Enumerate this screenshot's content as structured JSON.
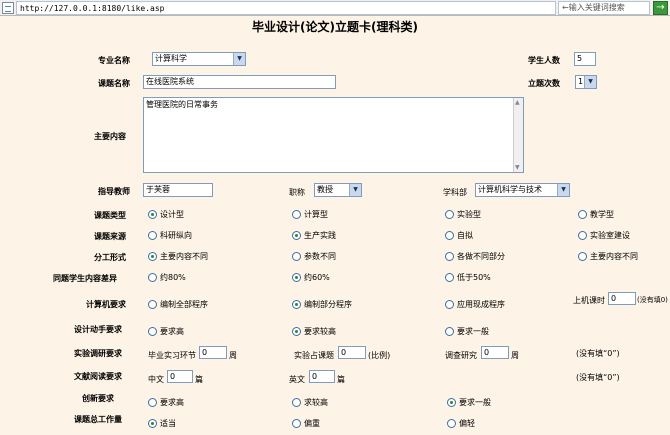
{
  "address": {
    "url": "http://127.0.0.1:8180/like.asp",
    "search_placeholder": "←输入关键词搜索",
    "go_label": "→"
  },
  "title": "毕业设计(论文)立题卡(理科类)",
  "major": {
    "label": "专业名称",
    "value": "计算科学"
  },
  "student_count": {
    "label": "学生人数",
    "value": "5"
  },
  "topic_name": {
    "label": "课题名称",
    "value": "在线医院系统"
  },
  "topic_times": {
    "label": "立题次数",
    "value": "1"
  },
  "main_content": {
    "label": "主要内容",
    "value": "管理医院的日常事务"
  },
  "teacher": {
    "label": "指导教师",
    "value": "于芙蓉"
  },
  "rank": {
    "label": "职称",
    "value": "教授"
  },
  "dept": {
    "label": "学科部",
    "value": "计算机科学与技术"
  },
  "topic_type": {
    "label": "课题类型",
    "options": [
      "设计型",
      "计算型",
      "实验型",
      "教学型"
    ],
    "selected": 0
  },
  "topic_source": {
    "label": "课题来源",
    "options": [
      "科研纵向",
      "生产实践",
      "自拟",
      "实验室建设"
    ],
    "selected": 1
  },
  "division": {
    "label": "分工形式",
    "options": [
      "主要内容不同",
      "参数不同",
      "各做不同部分",
      "主要内容不同"
    ],
    "selected": 0
  },
  "diff": {
    "label": "同题学生内容差异",
    "options": [
      "约80%",
      "约60%",
      "低于50%"
    ],
    "selected": 1
  },
  "computer_req": {
    "label": "计算机要求",
    "options": [
      "编制全部程序",
      "编制部分程序",
      "应用现成程序"
    ],
    "selected": 1,
    "hours_label": "上机课时",
    "hours_value": "0",
    "hours_note": "(没有填0)"
  },
  "design_req": {
    "label": "设计动手要求",
    "options": [
      "要求高",
      "要求较高",
      "要求一般"
    ],
    "selected": 1
  },
  "survey_req": {
    "label": "实验调研要求",
    "f1": "毕业实习环节",
    "v1": "0",
    "u1": "周",
    "f2": "实验占课题",
    "v2": "0",
    "u2": "(比例)",
    "f3": "调查研究",
    "v3": "0",
    "u3": "周",
    "note": "(没有填“0”)"
  },
  "reading_req": {
    "label": "文献阅读要求",
    "f1": "中文",
    "v1": "0",
    "u1": "篇",
    "f2": "英文",
    "v2": "0",
    "u2": "篇",
    "note": "(没有填“0”)"
  },
  "innovation": {
    "label": "创新要求",
    "options": [
      "要求高",
      "求较高",
      "要求一般"
    ],
    "selected": 2
  },
  "workload": {
    "label": "课题总工作量",
    "options": [
      "适当",
      "偏重",
      "偏轻"
    ],
    "selected": 0
  },
  "icons": {
    "dropdown": "chevron-down-icon",
    "page": "page-icon"
  }
}
